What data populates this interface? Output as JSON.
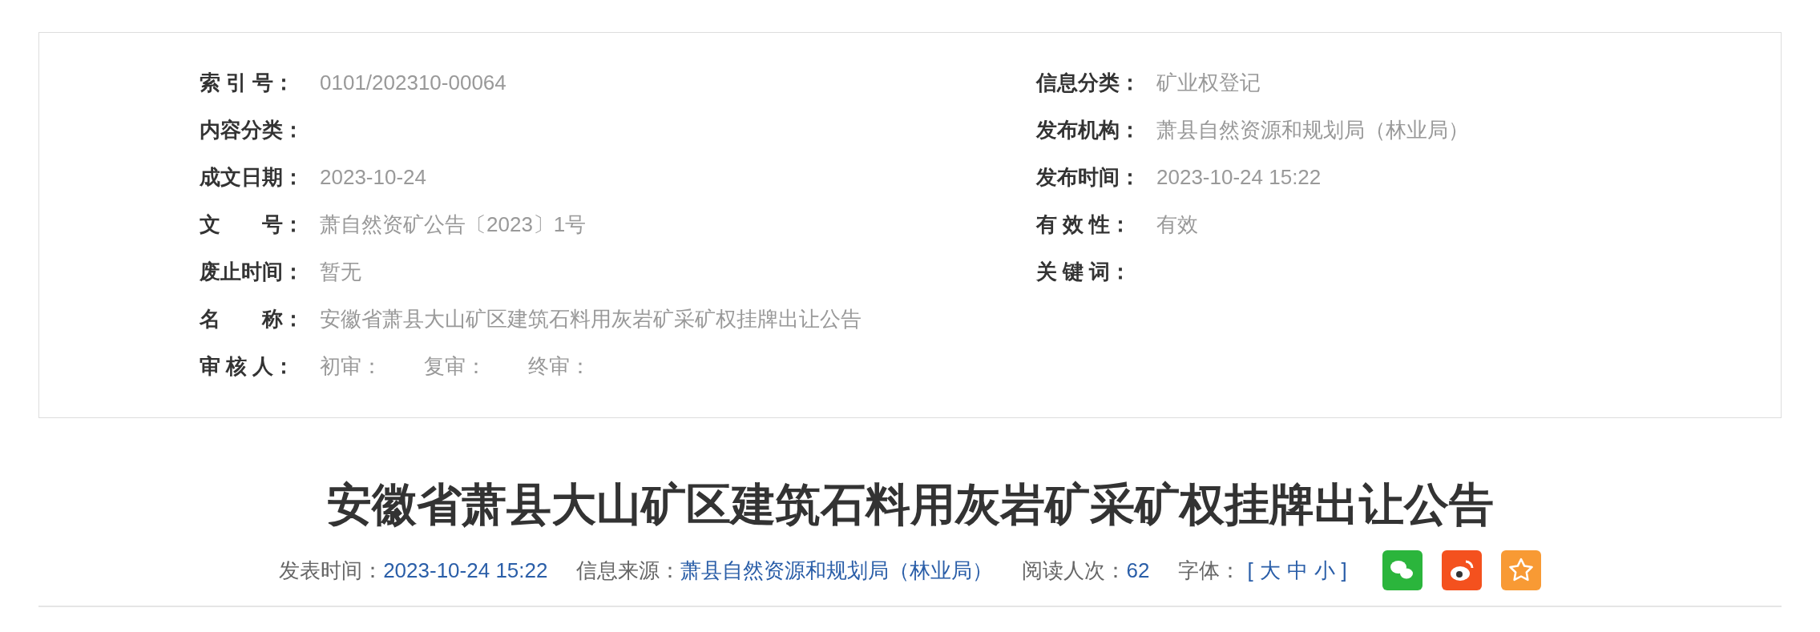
{
  "info_table": {
    "left": [
      {
        "label": "索 引 号：",
        "value": "0101/202310-00064"
      },
      {
        "label": "内容分类："
      },
      {
        "label": "成文日期：",
        "value": "2023-10-24"
      },
      {
        "label": "文　　号：",
        "value": "萧自然资矿公告〔2023〕1号"
      },
      {
        "label": "废止时间：",
        "value": "暂无"
      },
      {
        "label": "名　　称：",
        "value": "安徽省萧县大山矿区建筑石料用灰岩矿采矿权挂牌出让公告"
      },
      {
        "label": "审 核 人：",
        "value": "初审：　　复审：　　终审："
      }
    ],
    "right": [
      {
        "label": "信息分类：",
        "value": "矿业权登记"
      },
      {
        "label": "发布机构：",
        "value": "萧县自然资源和规划局（林业局）"
      },
      {
        "label": "发布时间：",
        "value": "2023-10-24 15:22"
      },
      {
        "label": "有 效 性：",
        "value": "有效"
      },
      {
        "label": "关 键 词："
      }
    ]
  },
  "article": {
    "title": "安徽省萧县大山矿区建筑石料用灰岩矿采矿权挂牌出让公告",
    "meta": [
      {
        "label": "发表时间：",
        "value": "2023-10-24 15:22"
      },
      {
        "label": "信息来源：",
        "value": "萧县自然资源和规划局（林业局）"
      },
      {
        "label": "阅读人次：",
        "value": "62"
      }
    ],
    "font_size": {
      "label": "字体：",
      "open": "[",
      "options": [
        "大",
        "中",
        "小"
      ],
      "close": "]"
    },
    "share": [
      {
        "kind": "wechat",
        "color": "#2bb53c"
      },
      {
        "kind": "weibo",
        "color": "#f4511e"
      },
      {
        "kind": "favorite",
        "color": "#f89a34"
      }
    ]
  }
}
